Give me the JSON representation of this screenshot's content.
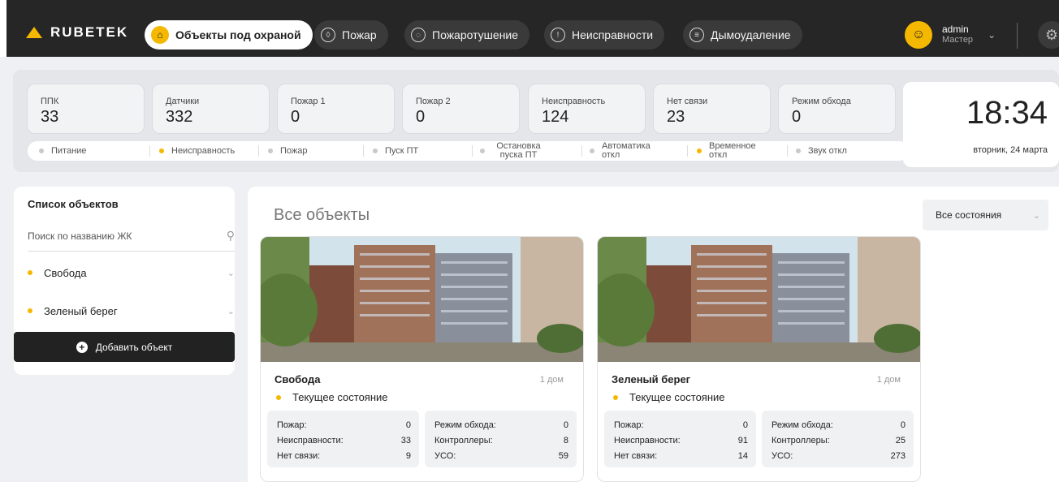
{
  "app": {
    "brand": "RUBETEK",
    "nav": [
      {
        "label": "Объекты под охраной",
        "icon": "home-icon",
        "active": true
      },
      {
        "label": "Пожар",
        "icon": "flame-icon",
        "active": false
      },
      {
        "label": "Пожаротушение",
        "icon": "extinguish-icon",
        "active": false
      },
      {
        "label": "Неисправности",
        "icon": "warning-icon",
        "active": false
      },
      {
        "label": "Дымоудаление",
        "icon": "smoke-icon",
        "active": false
      }
    ],
    "user": {
      "name": "admin",
      "role": "Мастер"
    }
  },
  "stats": [
    {
      "label": "ППК",
      "value": "33"
    },
    {
      "label": "Датчики",
      "value": "332"
    },
    {
      "label": "Пожар 1",
      "value": "0"
    },
    {
      "label": "Пожар 2",
      "value": "0"
    },
    {
      "label": "Неисправность",
      "value": "124"
    },
    {
      "label": "Нет связи",
      "value": "23"
    },
    {
      "label": "Режим обхода",
      "value": "0"
    }
  ],
  "status_indicators": [
    {
      "label": "Питание",
      "color": "#c9c9c9"
    },
    {
      "label": "Неисправность",
      "color": "#f5b800"
    },
    {
      "label": "Пожар",
      "color": "#c9c9c9"
    },
    {
      "label": "Пуск ПТ",
      "color": "#c9c9c9"
    },
    {
      "label": "Остановка пуска ПТ",
      "color": "#c9c9c9"
    },
    {
      "label": "Автоматика откл",
      "color": "#c9c9c9"
    },
    {
      "label": "Временное откл",
      "color": "#f5b800"
    },
    {
      "label": "Звук откл",
      "color": "#c9c9c9"
    }
  ],
  "clock": {
    "time": "18:34",
    "date": "вторник, 24 марта"
  },
  "sidebar": {
    "title": "Список объектов",
    "search_placeholder": "Поиск по названию ЖК",
    "items": [
      {
        "label": "Свобода",
        "color": "#f5b800"
      },
      {
        "label": "Зеленый берег",
        "color": "#f5b800"
      }
    ],
    "add_label": "Добавить объект"
  },
  "main": {
    "title": "Все объекты",
    "filter_label": "Все состояния",
    "cards": [
      {
        "name": "Свобода",
        "houses": "1 дом",
        "state": "Текущее состояние",
        "left": [
          {
            "k": "Пожар:",
            "v": "0"
          },
          {
            "k": "Неисправности:",
            "v": "33"
          },
          {
            "k": "Нет связи:",
            "v": "9"
          }
        ],
        "right": [
          {
            "k": "Режим обхода:",
            "v": "0"
          },
          {
            "k": "Контроллеры:",
            "v": "8"
          },
          {
            "k": "УСО:",
            "v": "59"
          }
        ]
      },
      {
        "name": "Зеленый берег",
        "houses": "1 дом",
        "state": "Текущее состояние",
        "left": [
          {
            "k": "Пожар:",
            "v": "0"
          },
          {
            "k": "Неисправности:",
            "v": "91"
          },
          {
            "k": "Нет связи:",
            "v": "14"
          }
        ],
        "right": [
          {
            "k": "Режим обхода:",
            "v": "0"
          },
          {
            "k": "Контроллеры:",
            "v": "25"
          },
          {
            "k": "УСО:",
            "v": "273"
          }
        ]
      }
    ]
  }
}
